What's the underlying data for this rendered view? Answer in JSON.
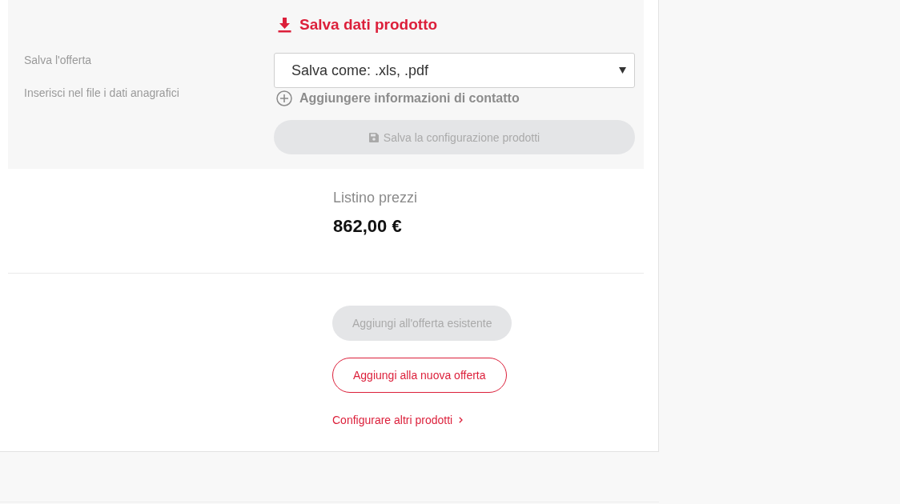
{
  "save_panel": {
    "labels": [
      "Salva l'offerta",
      "Inserisci nel file i dati anagrafici"
    ],
    "title": "Salva dati prodotto",
    "format_select": {
      "value": "Salva come: .xls, .pdf"
    },
    "add_contact_link": "Aggiungere informazioni di contatto",
    "save_button": {
      "label": "Salva la configurazione prodotti",
      "disabled": true
    }
  },
  "price": {
    "label": "Listino prezzi",
    "value": "862,00 €"
  },
  "actions": [
    {
      "label": "Aggiungi all'offerta esistente",
      "disabled": true
    },
    {
      "label": "Aggiungi alla nuova offerta",
      "disabled": false
    }
  ],
  "more_link": "Configurare altri prodotti"
}
